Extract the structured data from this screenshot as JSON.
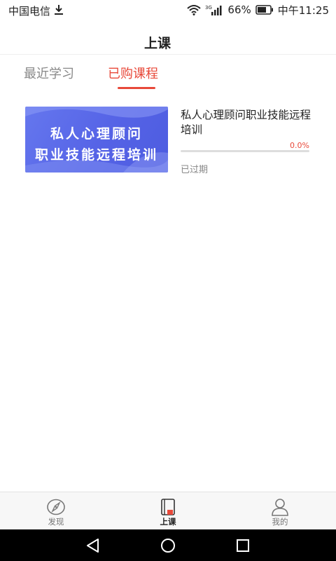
{
  "status_bar": {
    "carrier": "中国电信",
    "battery_percent": "66%",
    "time": "中午11:25",
    "network": "3G",
    "icons": [
      "download-icon",
      "wifi-icon",
      "signal-icon",
      "battery-icon"
    ]
  },
  "header": {
    "title": "上课"
  },
  "tabs": [
    {
      "label": "最近学习",
      "active": false
    },
    {
      "label": "已购课程",
      "active": true
    }
  ],
  "courses": [
    {
      "cover_lines": [
        "私人心理顾问",
        "职业技能远程培训"
      ],
      "title": "私人心理顾问职业技能远程培训",
      "progress_label": "0.0%",
      "progress": 0.0,
      "status": "已过期"
    }
  ],
  "bottom_nav": [
    {
      "label": "发现",
      "icon": "compass-icon",
      "active": false
    },
    {
      "label": "上课",
      "icon": "book-icon",
      "active": true
    },
    {
      "label": "我的",
      "icon": "user-icon",
      "active": false
    }
  ],
  "system_nav": [
    "back-icon",
    "home-icon",
    "recents-icon"
  ],
  "colors": {
    "accent": "#e8493a",
    "cover": "#5563e6"
  }
}
